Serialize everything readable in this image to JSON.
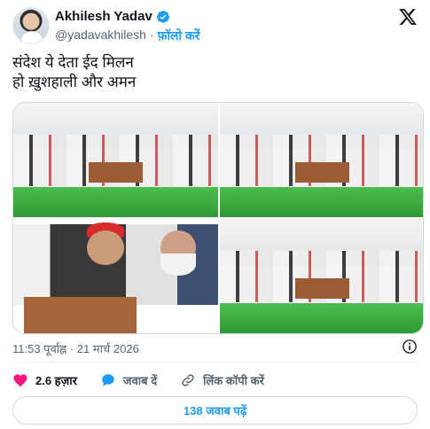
{
  "author": {
    "name": "Akhilesh Yadav",
    "handle": "@yadavakhilesh",
    "separator": "·",
    "follow_label": "फ़ॉलो करें"
  },
  "tweet": {
    "lines": [
      "संदेश ये देता ईद मिलन",
      "हो ख़ुशहाली और अमन"
    ]
  },
  "timestamp": "11:53 पूर्वाह्न · 21 मार्च 2026",
  "actions": {
    "likes": "2.6 हज़ार",
    "reply_label": "जवाब दें",
    "copy_link_label": "लिंक कॉपी करें"
  },
  "replies_button": "138 जवाब पढ़ें",
  "colors": {
    "accent": "#1d9bf0",
    "like": "#f91880",
    "muted": "#536471"
  }
}
